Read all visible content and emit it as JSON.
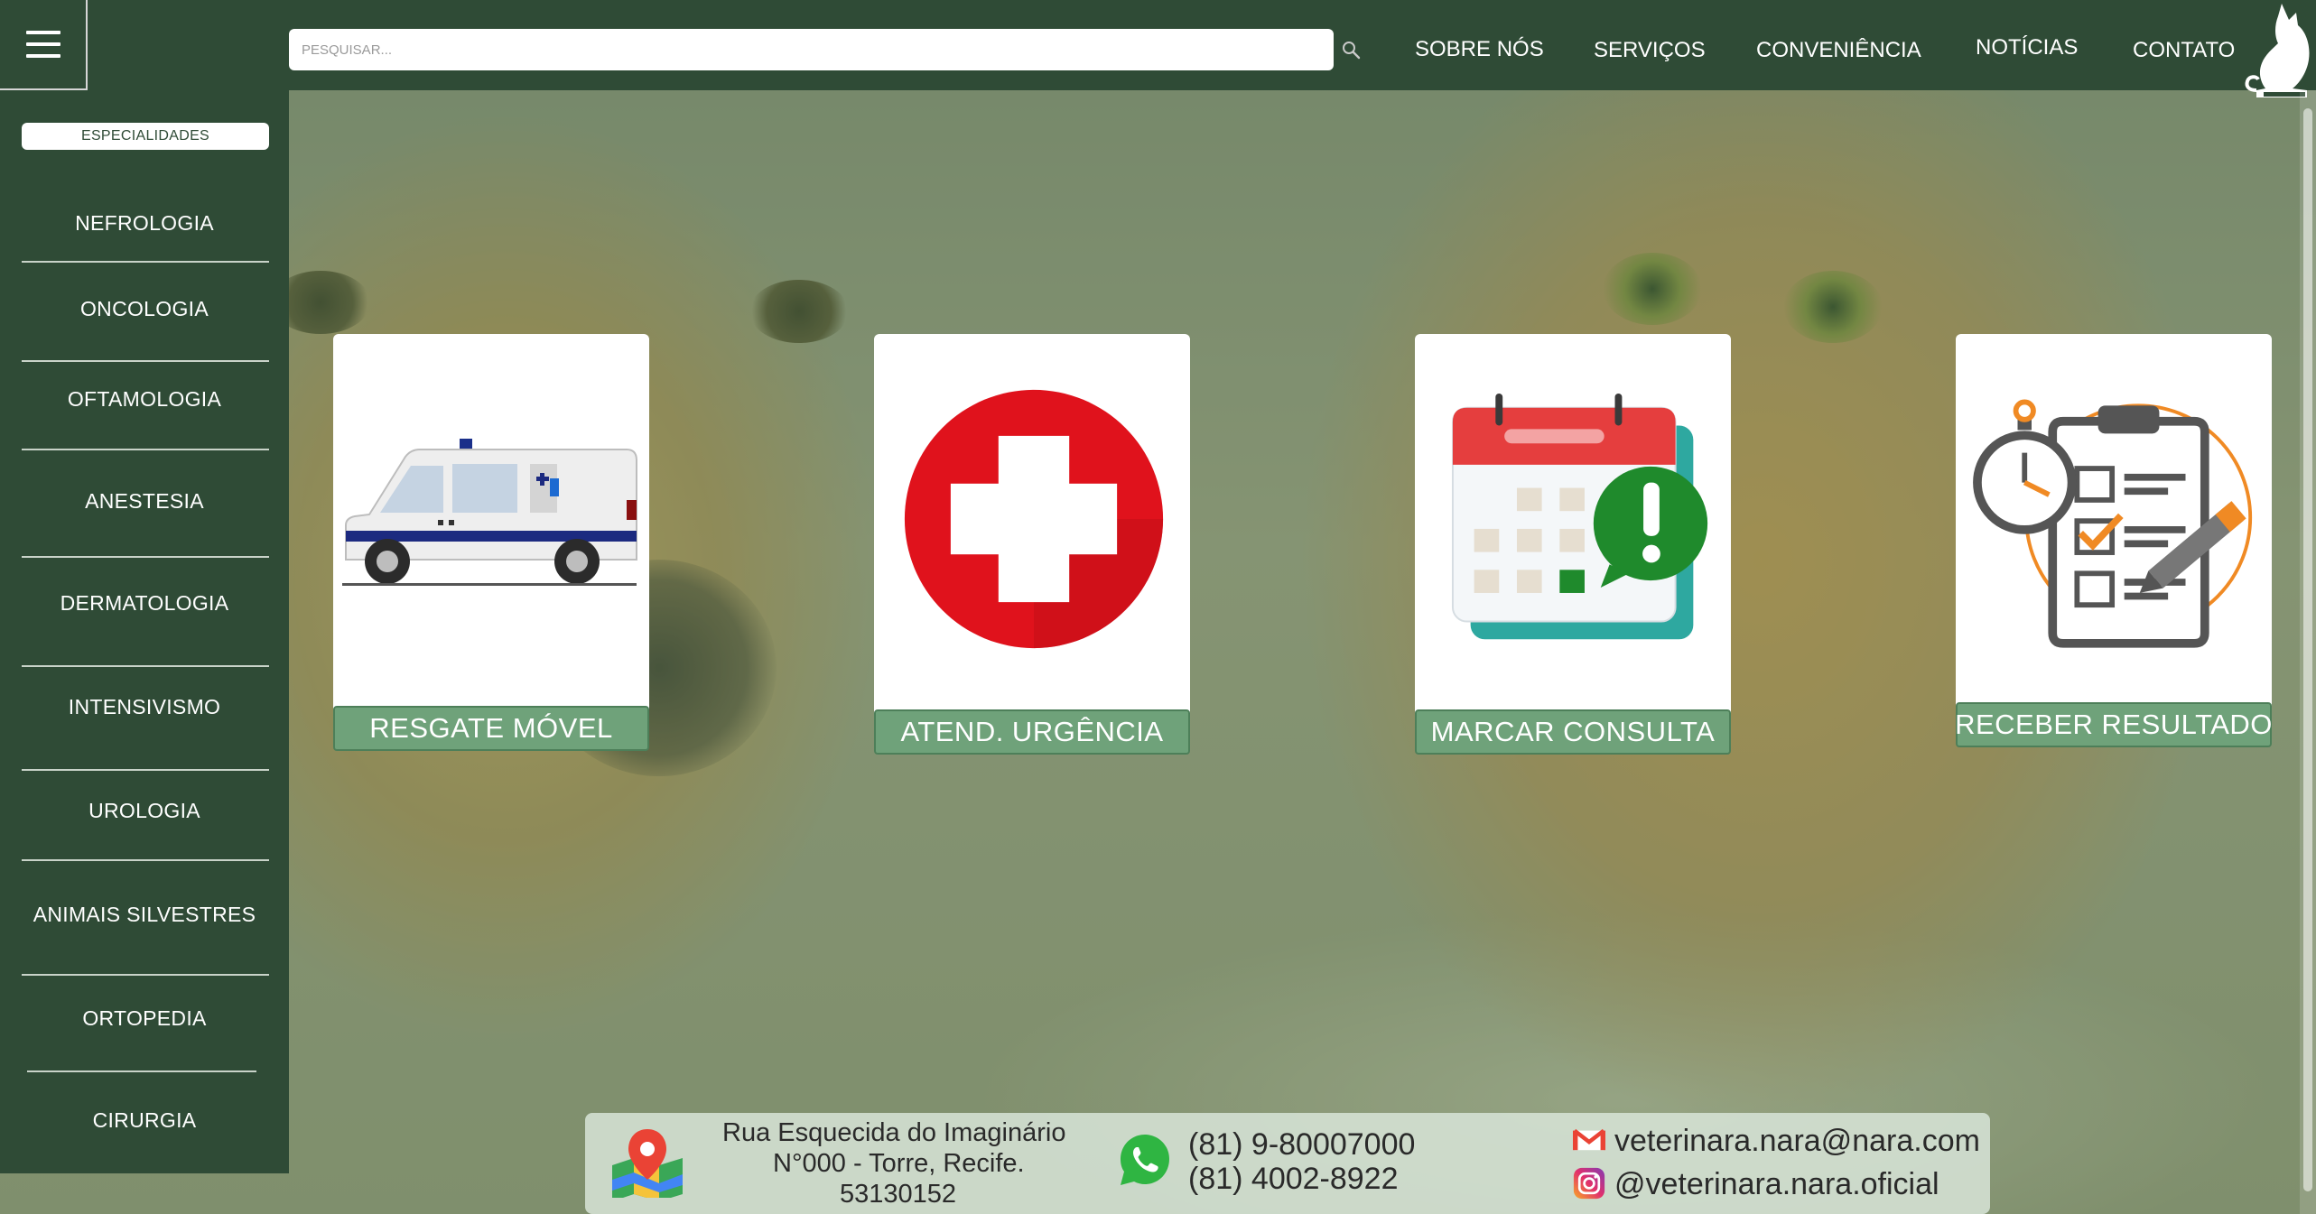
{
  "topbar": {
    "search_placeholder": "PESQUISAR...",
    "nav": [
      "SOBRE NÓS",
      "SERVIÇOS",
      "CONVENIÊNCIA",
      "NOTÍCIAS",
      "CONTATO"
    ]
  },
  "sidebar": {
    "header": "ESPECIALIDADES",
    "items": [
      "NEFROLOGIA",
      "ONCOLOGIA",
      "OFTAMOLOGIA",
      "ANESTESIA",
      "DERMATOLOGIA",
      "INTENSIVISMO",
      "UROLOGIA",
      "ANIMAIS SILVESTRES",
      "ORTOPEDIA",
      "CIRURGIA"
    ]
  },
  "cards": [
    {
      "label": "RESGATE MÓVEL",
      "icon": "ambulance-icon"
    },
    {
      "label": "ATEND. URGÊNCIA",
      "icon": "red-cross-icon"
    },
    {
      "label": "MARCAR CONSULTA",
      "icon": "calendar-alert-icon"
    },
    {
      "label": "RECEBER RESULTADO",
      "icon": "clipboard-checklist-icon"
    }
  ],
  "footer": {
    "address_line1": "Rua Esquecida do Imaginário",
    "address_line2": "N°000 - Torre, Recife.",
    "address_line3": "53130152",
    "phone1": "(81) 9-80007000",
    "phone2": "(81) 4002-8922",
    "email": "veterinara.nara@nara.com",
    "instagram": "@veterinara.nara.oficial"
  },
  "colors": {
    "primary": "#2f4b36",
    "card_label": "#6fa27a",
    "urgent_red": "#e0121c",
    "accent_orange": "#f08a24"
  }
}
